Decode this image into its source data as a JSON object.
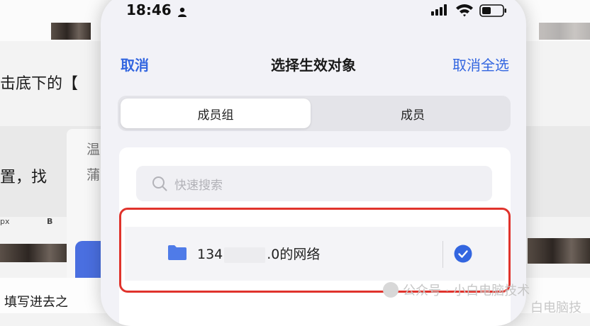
{
  "background_doc": {
    "line1": "击底下的【",
    "line2": "置，找",
    "line3": "填写进去之",
    "hint_1": "温",
    "hint_2": "蒲",
    "toolbar_px": "px",
    "toolbar_b": "B"
  },
  "watermark": {
    "text": "公众号 · 小白电脑技术",
    "corner": "白电脑技"
  },
  "status_bar": {
    "time": "18:46"
  },
  "nav": {
    "cancel": "取消",
    "title": "选择生效对象",
    "deselect_all": "取消全选"
  },
  "tabs": [
    {
      "label": "成员组",
      "selected": true
    },
    {
      "label": "成员",
      "selected": false
    }
  ],
  "search": {
    "placeholder": "快速搜索"
  },
  "list": {
    "item_prefix": "134",
    "item_suffix": ".0的网络",
    "checked": true
  },
  "colors": {
    "accent": "#3366e0",
    "highlight": "#e0332c",
    "folder": "#4f7be8"
  }
}
